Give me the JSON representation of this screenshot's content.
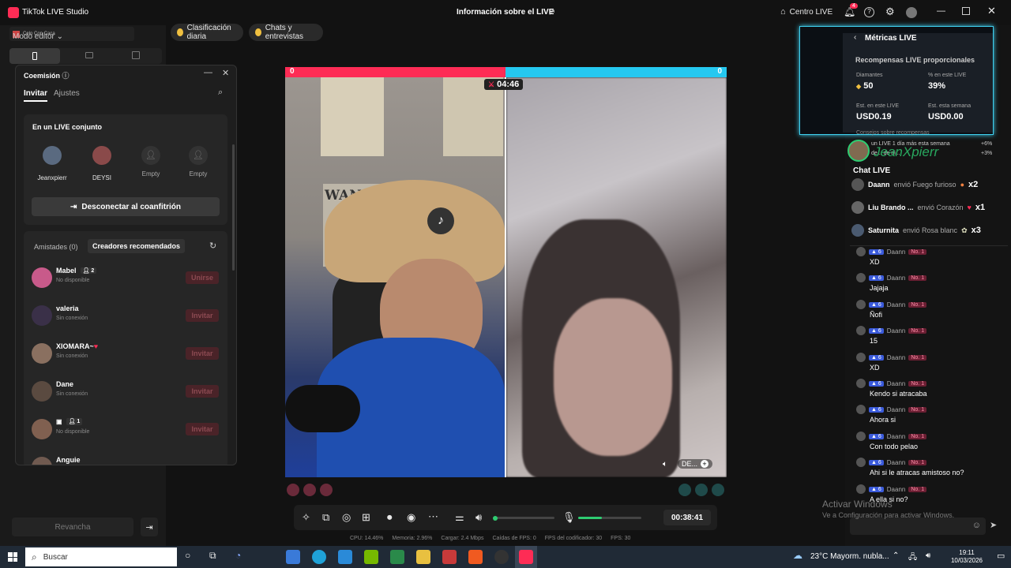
{
  "app": {
    "title": "TikTok LIVE Studio",
    "account_label": "Colo Con Caca",
    "mode_label": "Modo editor",
    "window_title": "Información sobre el LIVE",
    "centro_live": "Centro LIVE",
    "notif_count": "4"
  },
  "top_pills": [
    "Clasificación diaria",
    "Chats y entrevistas"
  ],
  "cohost": {
    "title": "Coemisión",
    "tabs": [
      "Invitar",
      "Ajustes"
    ],
    "joint_live_title": "En un LIVE conjunto",
    "participants": [
      "Jeanxpierr",
      "DEYSI",
      "Empty",
      "Empty"
    ],
    "disconnect_label": "Desconectar al coanfitrión",
    "friends_tab": "Amistades (0)",
    "recommended_tab": "Creadores recomendados",
    "creators": [
      {
        "name": "Mabel",
        "status": "No disponible",
        "count": "2",
        "action": "Unirse"
      },
      {
        "name": "valeria",
        "status": "Sin conexión",
        "action": "Invitar"
      },
      {
        "name": "XIOMARA~",
        "status": "Sin conexión",
        "action": "Invitar"
      },
      {
        "name": "Dane",
        "status": "Sin conexión",
        "action": "Invitar"
      },
      {
        "name": "",
        "status": "No disponible",
        "count": "1",
        "action": "Invitar"
      },
      {
        "name": "Anguie",
        "status": "",
        "action": "Invitar"
      }
    ]
  },
  "battle": {
    "left_score": "0",
    "right_score": "0",
    "timer": "04:46",
    "right_label": "DE..."
  },
  "controls": {
    "elapsed": "00:38:41",
    "volume_level": 0.0,
    "mic_level": 0.38
  },
  "stats": {
    "cpu": "CPU: 14.46%",
    "memory": "Memoria: 2.96%",
    "upload": "Cargar: 2.4 Mbps",
    "fps_drops": "Caídas de FPS: 0",
    "encoder_fps": "FPS del codificador: 30",
    "fps": "FPS: 30"
  },
  "left_panel": {
    "rematch_label": "Revancha"
  },
  "metrics": {
    "title": "Métricas LIVE",
    "section": "Recompensas LIVE proporcionales",
    "diamonds_label": "Diamantes",
    "diamonds_value": "50",
    "pct_label": "% en este LIVE",
    "pct_value": "39%",
    "est_live_label": "Est. en este LIVE",
    "est_live_value": "USD0.19",
    "est_week_label": "Est. esta semana",
    "est_week_value": "USD0.00",
    "tips_label": "Consejos sobre recompensas",
    "tip1": "un LIVE 1 día más esta semana",
    "tip1_pct": "+6%",
    "tip2": "de... de ni...",
    "tip2_pct": "+3%"
  },
  "streamer_overlay": "JeanXpierr",
  "chat": {
    "title": "Chat LIVE",
    "gifts": [
      {
        "user": "Daann",
        "text": "envió Fuego furioso",
        "mult": "x2"
      },
      {
        "user": "Liu Brando ...",
        "text": "envió Corazón",
        "mult": "x1"
      },
      {
        "user": "Saturnita",
        "text": "envió Rosa blanc",
        "mult": "x3"
      }
    ],
    "level": "6",
    "rank": "No. 1",
    "messages": [
      {
        "user": "Daann",
        "text": "XD"
      },
      {
        "user": "Daann",
        "text": "Jajaja"
      },
      {
        "user": "Daann",
        "text": "Ñofi"
      },
      {
        "user": "Daann",
        "text": "15"
      },
      {
        "user": "Daann",
        "text": "XD"
      },
      {
        "user": "Daann",
        "text": "Kendo si atracaba"
      },
      {
        "user": "Daann",
        "text": "Ahora si"
      },
      {
        "user": "Daann",
        "text": "Con todo pelao"
      },
      {
        "user": "Daann",
        "text": "Ahi si le atracas amistoso no?"
      },
      {
        "user": "Daann",
        "text": "A ella si no?"
      }
    ]
  },
  "watermark": {
    "line1": "Activar Windows",
    "line2": "Ve a Configuración para activar Windows."
  },
  "taskbar": {
    "search_placeholder": "Buscar",
    "weather": "23°C  Mayorm. nubla...",
    "time": "19:11",
    "date": "10/03/2026"
  },
  "colors": {
    "accent_pink": "#fe2c55",
    "accent_cyan": "#25f4ee",
    "green": "#2ecc71"
  }
}
